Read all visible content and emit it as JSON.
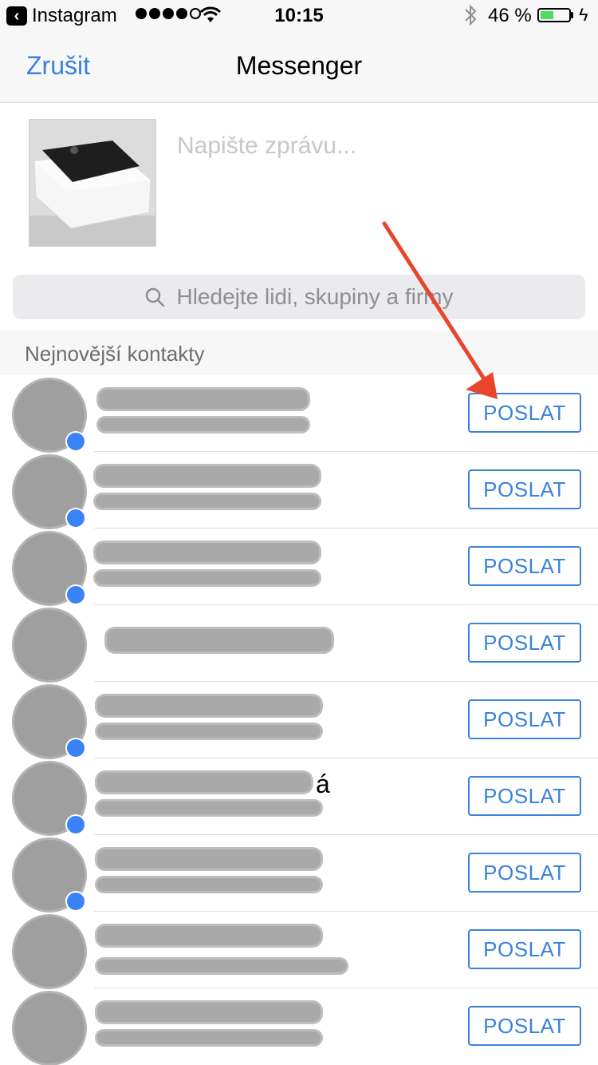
{
  "status_bar": {
    "back_app": "Instagram",
    "time": "10:15",
    "battery_percent": "46 %",
    "battery_level": 0.46
  },
  "nav": {
    "cancel_label": "Zrušit",
    "title": "Messenger"
  },
  "compose": {
    "message_placeholder": "Napište zprávu..."
  },
  "search": {
    "placeholder": "Hledejte lidi, skupiny a firmy"
  },
  "section": {
    "title": "Nejnovější kontakty"
  },
  "contacts": [
    {
      "name_visible": "",
      "send_label": "POSLAT"
    },
    {
      "name_visible": "",
      "send_label": "POSLAT"
    },
    {
      "name_visible": "",
      "send_label": "POSLAT"
    },
    {
      "name_visible": "",
      "send_label": "POSLAT"
    },
    {
      "name_visible": "",
      "send_label": "POSLAT"
    },
    {
      "name_visible": "á",
      "send_label": "POSLAT"
    },
    {
      "name_visible": "",
      "send_label": "POSLAT"
    },
    {
      "name_visible": "",
      "send_label": "POSLAT"
    },
    {
      "name_visible": "",
      "send_label": "POSLAT"
    }
  ],
  "colors": {
    "accent": "#3a82db",
    "annotation_arrow": "#e8452c"
  }
}
